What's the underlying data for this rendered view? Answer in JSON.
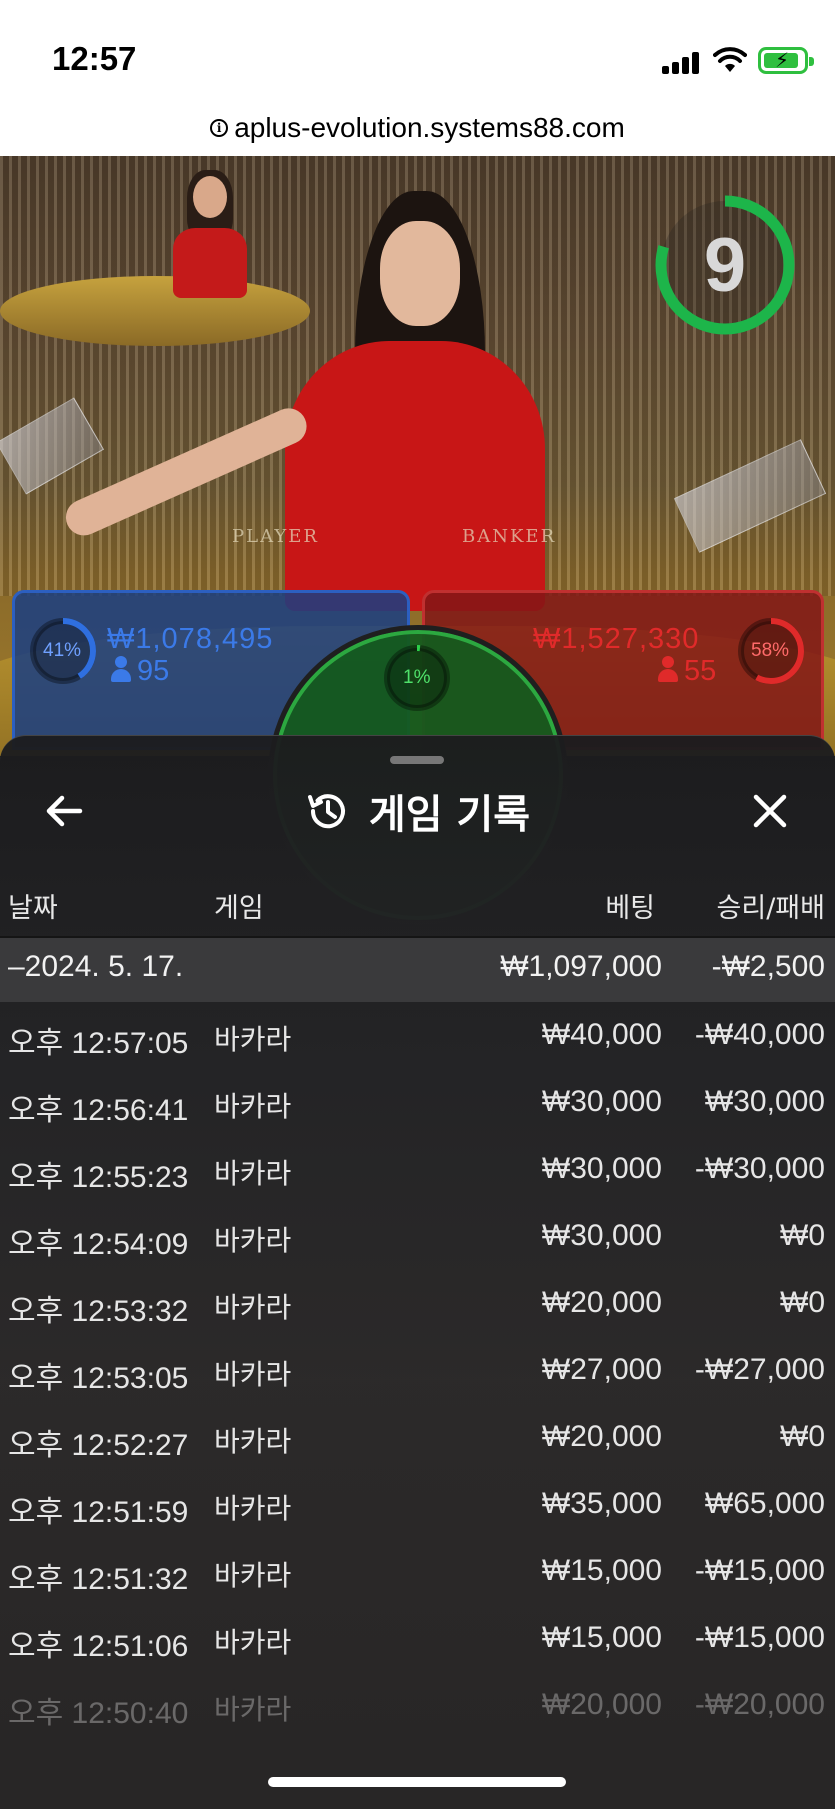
{
  "status_bar": {
    "time": "12:57"
  },
  "browser": {
    "url": "aplus-evolution.systems88.com"
  },
  "game": {
    "timer": "9",
    "table_labels": [
      "PLAYER",
      "BANKER"
    ],
    "player": {
      "percent": "41%",
      "amount": "₩1,078,495",
      "players": "95",
      "color": "#2c5fc0"
    },
    "banker": {
      "percent": "58%",
      "amount": "₩1,527,330",
      "players": "55",
      "color": "#c03030"
    },
    "tie": {
      "percent": "1%",
      "color": "#2ca840"
    }
  },
  "panel": {
    "title": "게임 기록",
    "back_icon": "arrow-left-icon",
    "history_icon": "history-icon",
    "close_icon": "close-icon",
    "columns": {
      "date": "날짜",
      "game": "게임",
      "bet": "베팅",
      "result": "승리/패배"
    },
    "date_group": {
      "date": "–2024. 5. 17.",
      "bet": "₩1,097,000",
      "result": "-₩2,500"
    },
    "rows": [
      {
        "time": "오후 12:57:05",
        "game": "바카라",
        "bet": "₩40,000",
        "result": "-₩40,000"
      },
      {
        "time": "오후 12:56:41",
        "game": "바카라",
        "bet": "₩30,000",
        "result": "₩30,000"
      },
      {
        "time": "오후 12:55:23",
        "game": "바카라",
        "bet": "₩30,000",
        "result": "-₩30,000"
      },
      {
        "time": "오후 12:54:09",
        "game": "바카라",
        "bet": "₩30,000",
        "result": "₩0"
      },
      {
        "time": "오후 12:53:32",
        "game": "바카라",
        "bet": "₩20,000",
        "result": "₩0"
      },
      {
        "time": "오후 12:53:05",
        "game": "바카라",
        "bet": "₩27,000",
        "result": "-₩27,000"
      },
      {
        "time": "오후 12:52:27",
        "game": "바카라",
        "bet": "₩20,000",
        "result": "₩0"
      },
      {
        "time": "오후 12:51:59",
        "game": "바카라",
        "bet": "₩35,000",
        "result": "₩65,000"
      },
      {
        "time": "오후 12:51:32",
        "game": "바카라",
        "bet": "₩15,000",
        "result": "-₩15,000"
      },
      {
        "time": "오후 12:51:06",
        "game": "바카라",
        "bet": "₩15,000",
        "result": "-₩15,000"
      },
      {
        "time": "오후 12:50:40",
        "game": "바카라",
        "bet": "₩20,000",
        "result": "-₩20,000"
      }
    ]
  }
}
